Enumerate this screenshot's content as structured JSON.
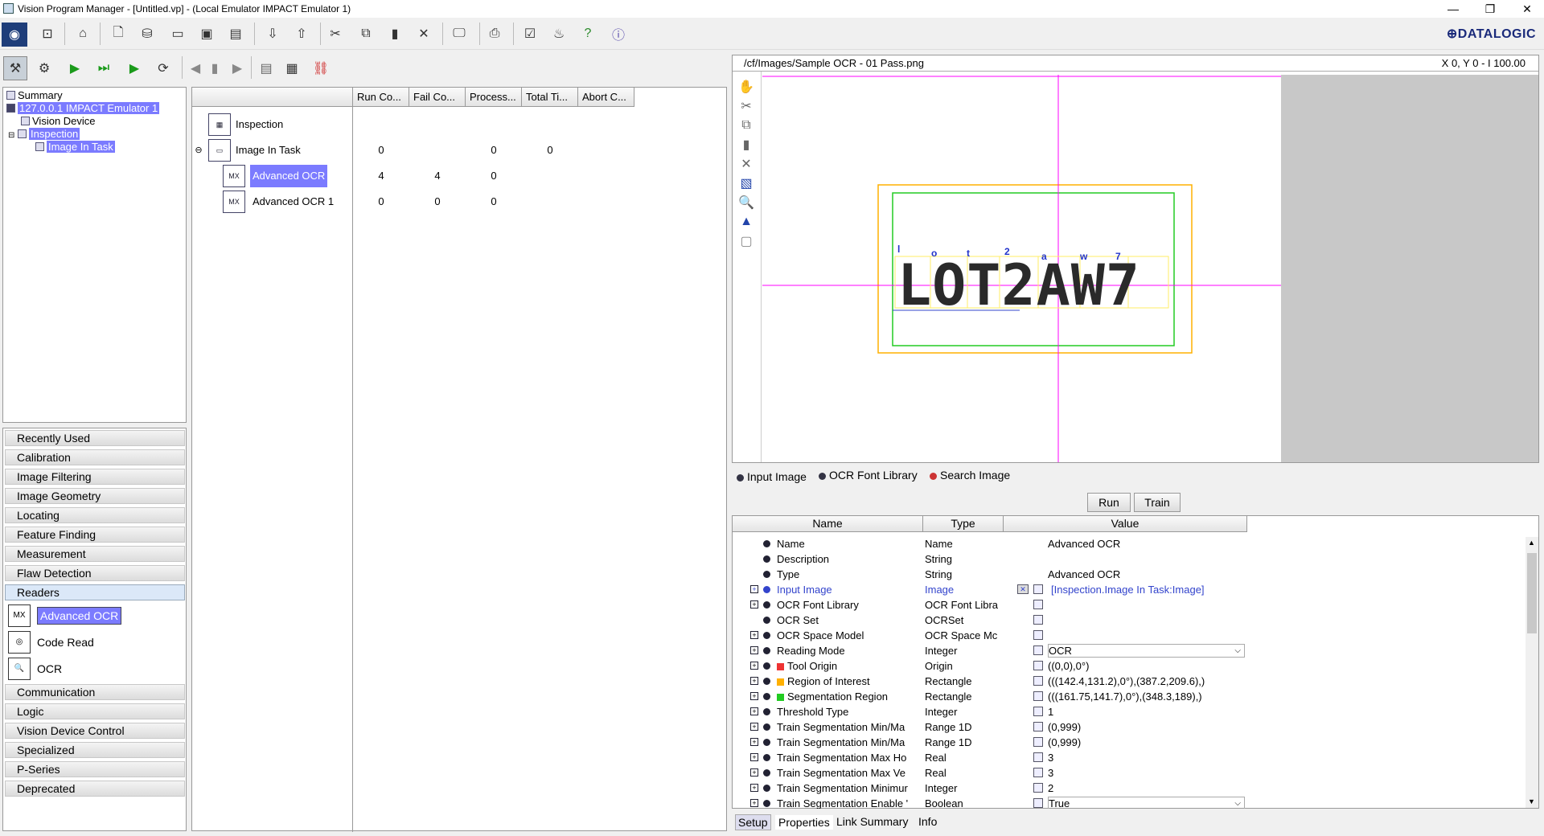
{
  "window": {
    "title": "Vision Program Manager - [Untitled.vp] - (Local Emulator IMPACT Emulator 1)",
    "minimize": "—",
    "restore": "❐",
    "close": "✕"
  },
  "brand": {
    "logo": "⊕DATALOGIC"
  },
  "tree": {
    "summary": "Summary",
    "device_ip": "127.0.0.1 IMPACT Emulator 1",
    "vision_device": "Vision Device",
    "inspection": "Inspection",
    "image_in_task": "Image In Task"
  },
  "categories": [
    "Recently Used",
    "Calibration",
    "Image Filtering",
    "Image Geometry",
    "Locating",
    "Feature Finding",
    "Measurement",
    "Flaw Detection",
    "Readers",
    "Communication",
    "Logic",
    "Vision Device Control",
    "Specialized",
    "P-Series",
    "Deprecated"
  ],
  "reader_tools": [
    "Advanced OCR",
    "Code Read",
    "OCR"
  ],
  "mid_table": {
    "columns": [
      "Run Co...",
      "Fail Co...",
      "Process...",
      "Total Ti...",
      "Abort C..."
    ],
    "rows": [
      {
        "name": "Inspection",
        "values": [
          "",
          "",
          "",
          "",
          ""
        ]
      },
      {
        "name": "Image In Task",
        "values": [
          "0",
          "",
          "0",
          "0",
          ""
        ]
      },
      {
        "name": "Advanced OCR",
        "values": [
          "4",
          "4",
          "0",
          "",
          ""
        ]
      },
      {
        "name": "Advanced OCR 1",
        "values": [
          "0",
          "0",
          "0",
          "",
          ""
        ]
      }
    ]
  },
  "image_panel": {
    "path": "/cf/Images/Sample OCR - 01 Pass.png",
    "coords": "X 0,  Y 0  -  I 100.00",
    "ocr_text": "LOT2AW7",
    "ocr_chars": [
      "l",
      "o",
      "t",
      "2",
      "a",
      "w",
      "7"
    ]
  },
  "image_tabs": [
    "Input Image",
    "OCR Font Library",
    "Search Image"
  ],
  "buttons": {
    "run": "Run",
    "train": "Train"
  },
  "prop_columns": [
    "Name",
    "Type",
    "Value"
  ],
  "properties": [
    {
      "name": "Name",
      "type": "Name",
      "value": "Advanced OCR"
    },
    {
      "name": "Description",
      "type": "String",
      "value": ""
    },
    {
      "name": "Type",
      "type": "String",
      "value": "Advanced OCR"
    },
    {
      "name": "Input Image",
      "type": "Image",
      "value": "[Inspection.Image In Task:Image]"
    },
    {
      "name": "OCR Font Library",
      "type": "OCR Font Libra",
      "value": ""
    },
    {
      "name": "OCR Set",
      "type": "OCRSet",
      "value": ""
    },
    {
      "name": "OCR Space Model",
      "type": "OCR Space Mc",
      "value": ""
    },
    {
      "name": "Reading Mode",
      "type": "Integer",
      "value": "OCR"
    },
    {
      "name": "Tool Origin",
      "type": "Origin",
      "value": "((0,0),0°)"
    },
    {
      "name": "Region of Interest",
      "type": "Rectangle",
      "value": "(((142.4,131.2),0°),(387.2,209.6),)"
    },
    {
      "name": "Segmentation Region",
      "type": "Rectangle",
      "value": "(((161.75,141.7),0°),(348.3,189),)"
    },
    {
      "name": "Threshold Type",
      "type": "Integer",
      "value": "1"
    },
    {
      "name": "Train Segmentation Min/Ma",
      "type": "Range 1D",
      "value": "(0,999)"
    },
    {
      "name": "Train Segmentation Min/Ma",
      "type": "Range 1D",
      "value": "(0,999)"
    },
    {
      "name": "Train Segmentation Max Ho",
      "type": "Real",
      "value": "3"
    },
    {
      "name": "Train Segmentation Max Ve",
      "type": "Real",
      "value": "3"
    },
    {
      "name": "Train Segmentation Minimur",
      "type": "Integer",
      "value": "2"
    },
    {
      "name": "Train Segmentation Enable '",
      "type": "Boolean",
      "value": "True"
    }
  ],
  "bottom_tabs": [
    "Setup",
    "Properties",
    "Link Summary",
    "Info"
  ],
  "colors": {
    "selection": "#7b7bff",
    "roi": "#ffb000",
    "segmentation": "#22cc22",
    "crosshair": "#ff00ff"
  }
}
